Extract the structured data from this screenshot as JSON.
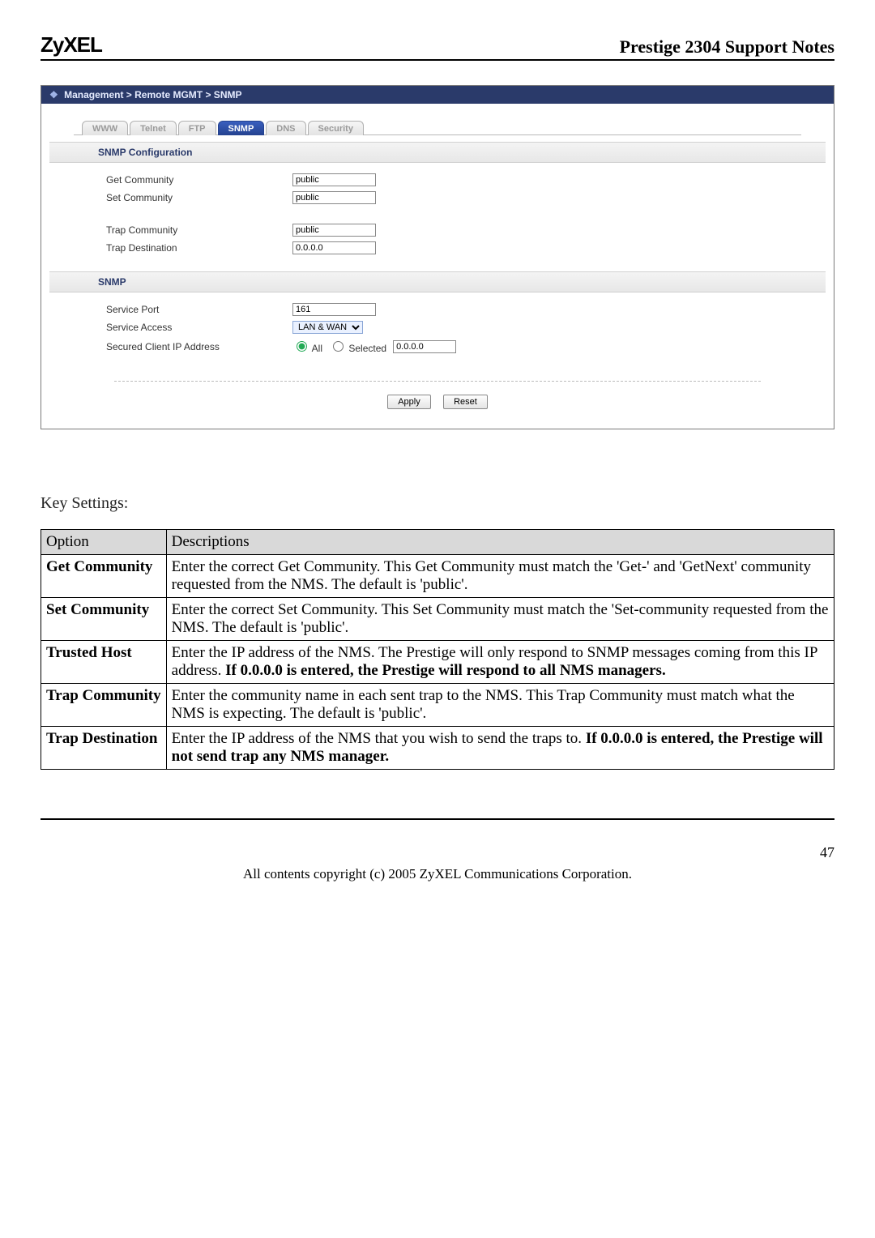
{
  "header": {
    "logo": "ZyXEL",
    "title": "Prestige 2304 Support Notes"
  },
  "screenshot": {
    "breadcrumb": "Management > Remote MGMT > SNMP",
    "tabs": [
      "WWW",
      "Telnet",
      "FTP",
      "SNMP",
      "DNS",
      "Security"
    ],
    "active_tab": "SNMP",
    "section1_title": "SNMP Configuration",
    "get_community_label": "Get Community",
    "get_community_value": "public",
    "set_community_label": "Set Community",
    "set_community_value": "public",
    "trap_community_label": "Trap  Community",
    "trap_community_value": "public",
    "trap_destination_label": "Trap  Destination",
    "trap_destination_value": "0.0.0.0",
    "section2_title": "SNMP",
    "service_port_label": "Service Port",
    "service_port_value": "161",
    "service_access_label": "Service Access",
    "service_access_value": "LAN & WAN",
    "secured_ip_label": "Secured Client IP Address",
    "radio_all": "All",
    "radio_selected": "Selected",
    "secured_ip_value": "0.0.0.0",
    "apply": "Apply",
    "reset": "Reset"
  },
  "key_settings_label": "Key Settings:",
  "table": {
    "head_option": "Option",
    "head_desc": "Descriptions",
    "rows": [
      {
        "opt": "Get Community",
        "desc_plain": "Enter the correct Get Community. This Get Community must match the 'Get-' and 'GetNext' community requested from the NMS. The default is 'public'."
      },
      {
        "opt": "Set Community",
        "desc_plain": "Enter the correct Set Community. This Set Community must match the 'Set-community requested from the NMS. The default is 'public'."
      },
      {
        "opt": "Trusted Host",
        "desc_pre": "Enter the IP address of the NMS. The Prestige will only respond to SNMP messages coming from this IP address. ",
        "desc_bold": "If 0.0.0.0 is entered, the Prestige will respond to all NMS managers."
      },
      {
        "opt": "Trap Community",
        "desc_plain": "Enter the community name in each sent trap to the NMS. This Trap Community must match what the NMS is expecting. The default is 'public'."
      },
      {
        "opt": "Trap Destination",
        "desc_pre": "Enter the IP address of the NMS that you wish to send the traps to. ",
        "desc_bold": "If 0.0.0.0 is entered, the Prestige will not send trap any NMS manager."
      }
    ]
  },
  "footer": {
    "page": "47",
    "copyright": "All contents copyright (c) 2005 ZyXEL Communications Corporation."
  }
}
